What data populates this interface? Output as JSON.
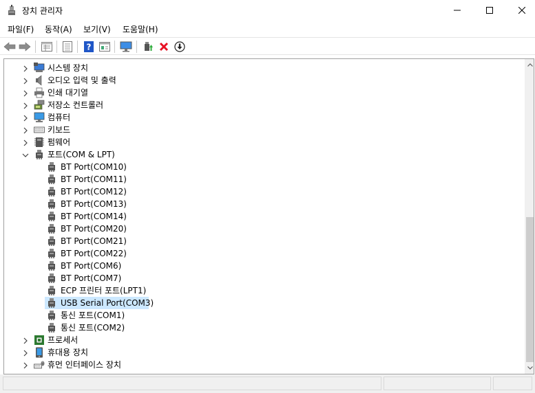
{
  "window": {
    "title": "장치 관리자"
  },
  "menu": [
    "파일(F)",
    "동작(A)",
    "보기(V)",
    "도움말(H)"
  ],
  "toolbar": {
    "buttons": [
      "back-icon",
      "forward-icon",
      "properties-view-icon",
      "show-hidden-icon",
      "help-icon",
      "details-icon",
      "monitor-icon",
      "update-driver-icon",
      "uninstall-icon",
      "download-icon"
    ]
  },
  "tree": {
    "categories_top": [
      {
        "label": "시스템 장치",
        "icon": "system-devices-icon"
      },
      {
        "label": "오디오 입력 및 출력",
        "icon": "speaker-icon"
      },
      {
        "label": "인쇄 대기열",
        "icon": "printer-icon"
      },
      {
        "label": "저장소 컨트롤러",
        "icon": "storage-controller-icon"
      },
      {
        "label": "컴퓨터",
        "icon": "computer-icon"
      },
      {
        "label": "키보드",
        "icon": "keyboard-icon"
      },
      {
        "label": "펌웨어",
        "icon": "firmware-icon"
      }
    ],
    "ports_category": {
      "label": "포트(COM & LPT)",
      "icon": "port-icon"
    },
    "ports": [
      "BT Port(COM10)",
      "BT Port(COM11)",
      "BT Port(COM12)",
      "BT Port(COM13)",
      "BT Port(COM14)",
      "BT Port(COM20)",
      "BT Port(COM21)",
      "BT Port(COM22)",
      "BT Port(COM6)",
      "BT Port(COM7)",
      "ECP 프린터 포트(LPT1)",
      "USB Serial Port(COM3)",
      "통신 포트(COM1)",
      "통신 포트(COM2)"
    ],
    "selected_port": "USB Serial Port(COM3)",
    "categories_bottom": [
      {
        "label": "프로세서",
        "icon": "processor-icon"
      },
      {
        "label": "휴대용 장치",
        "icon": "portable-device-icon"
      },
      {
        "label": "휴먼 인터페이스 장치",
        "icon": "hid-icon"
      }
    ]
  },
  "colors": {
    "selection": "#cce8ff",
    "close_red": "#e81123",
    "help_blue": "#1f56c7"
  }
}
